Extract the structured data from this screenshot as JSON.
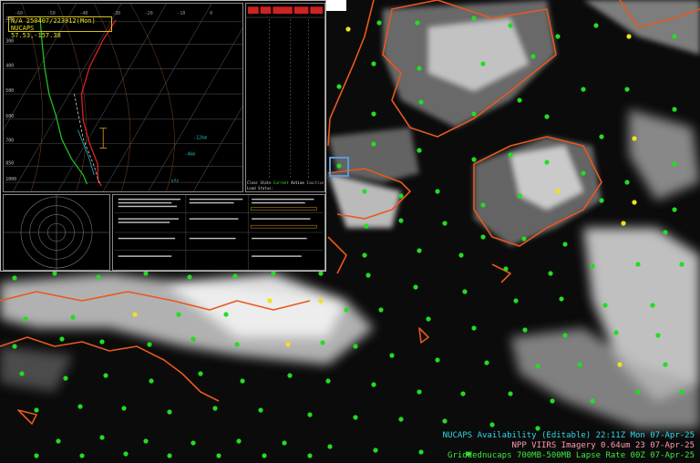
{
  "sounding": {
    "title_line1": "N/A 250407/223912(Mon) NUCAPS",
    "title_line2": "57.53,-157.38"
  },
  "load_panel": {
    "clear_state": "Clear State",
    "current": "Current",
    "active": "Active",
    "inactive": "Inactive",
    "load_status": "Load Status:"
  },
  "legend": {
    "line1": "NUCAPS Availability (Editable)",
    "line1_time": "22:11Z Mon 07-Apr-25",
    "line2": "NPP VIIRS Imagery 0.64um",
    "line2_time": "23 07-Apr-25",
    "line3": "Griddednucaps 700MB-500MB Lapse Rate",
    "line3_time": "00Z 07-Apr-25"
  },
  "colors": {
    "coast": "#e8581e",
    "point_green": "#22dd22",
    "point_yellow": "#f0e020",
    "legend_cyan": "#2fd8e8",
    "legend_pink": "#ff9cb0",
    "legend_green": "#3ee83e",
    "temp_line": "#e02020",
    "dew_line": "#20c020"
  },
  "icons": {
    "selection": "selected-sounding-box"
  }
}
